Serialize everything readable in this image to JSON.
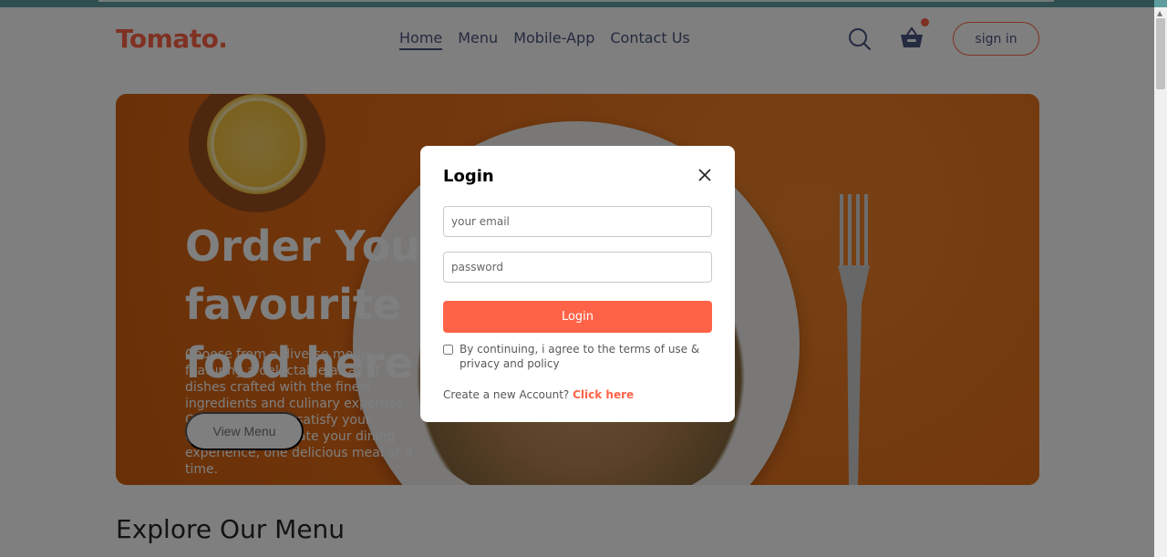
{
  "header": {
    "logo": "Tomato.",
    "nav": [
      "Home",
      "Menu",
      "Mobile-App",
      "Contact Us"
    ],
    "active_nav": "Home",
    "sign_in_label": "sign in",
    "search_icon": "search-icon",
    "basket_icon": "basket-icon"
  },
  "hero": {
    "title": "Order Your favourite food here",
    "description": "Choose from a diverse menu featuring a delectable array of dishes crafted with the finest ingredients and culinary expertise. Our mission is to satisfy your cravings and elevate your dining experience, one delicious meal at a time.",
    "button_label": "View Menu"
  },
  "explore": {
    "title": "Explore Our Menu"
  },
  "login_modal": {
    "title": "Login",
    "close_icon": "close-icon",
    "email_placeholder": "your email",
    "password_placeholder": "password",
    "submit_label": "Login",
    "consent_text": "By continuing, i agree to the terms of use & privacy and policy",
    "create_text": "Create a new Account?",
    "create_link": "Click here"
  },
  "colors": {
    "accent": "#ff6347",
    "text": "#49557e",
    "hero_orange": "#e8731f"
  }
}
